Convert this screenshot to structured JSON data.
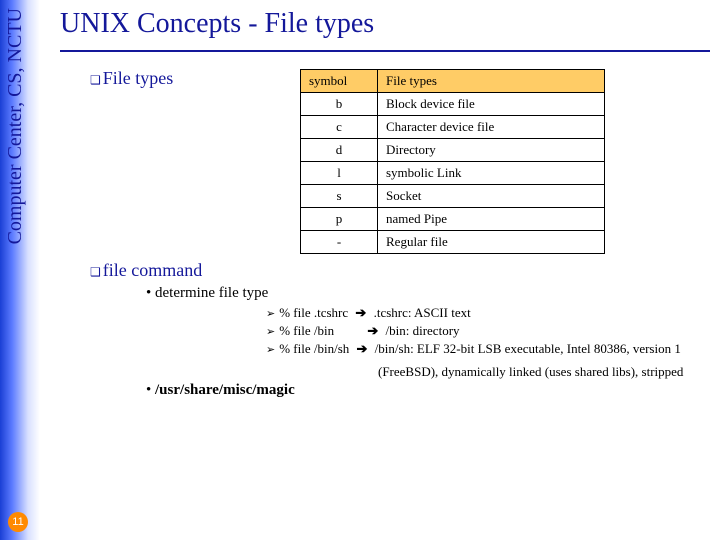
{
  "side_label": "Computer Center, CS, NCTU",
  "page_number": "11",
  "title": "UNIX Concepts - File types",
  "sections": {
    "filetypes_heading": "File types",
    "filecmd_heading": "file command"
  },
  "table": {
    "headers": {
      "c0": "symbol",
      "c1": "File types"
    },
    "rows": [
      {
        "sym": "b",
        "desc": "Block device file"
      },
      {
        "sym": "c",
        "desc": "Character device file"
      },
      {
        "sym": "d",
        "desc": "Directory"
      },
      {
        "sym": "l",
        "desc": "symbolic Link"
      },
      {
        "sym": "s",
        "desc": "Socket"
      },
      {
        "sym": "p",
        "desc": "named Pipe"
      },
      {
        "sym": "-",
        "desc": "Regular file"
      }
    ]
  },
  "filecmd": {
    "b1": "determine file type",
    "ex1_in": "% file .tcshrc",
    "ex1_out": ".tcshrc: ASCII text",
    "ex2_in": "% file /bin",
    "ex2_out": "/bin: directory",
    "ex3_in": "% file /bin/sh",
    "ex3_out": "/bin/sh: ELF 32-bit LSB executable, Intel 80386, version 1",
    "ex3_out2": "(FreeBSD), dynamically linked (uses shared libs), stripped",
    "b2": "/usr/share/misc/magic"
  },
  "glyphs": {
    "sq": "❑",
    "tri": "➢",
    "arr": "➔"
  }
}
